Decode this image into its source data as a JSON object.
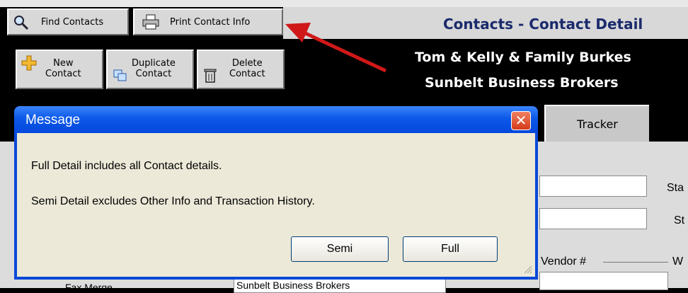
{
  "toolbar": {
    "find_contacts": "Find Contacts",
    "print_contact_info": "Print Contact Info",
    "new_contact": "New\nContact",
    "duplicate_contact": "Duplicate\nContact",
    "delete_contact": "Delete\nContact"
  },
  "header": {
    "title": "Contacts - Contact Detail",
    "contact_name": "Tom & Kelly & Family Burkes",
    "company": "Sunbelt Business Brokers"
  },
  "tabs": {
    "tracker": "Tracker"
  },
  "form": {
    "label_sta": "Sta",
    "label_st": "St",
    "vendor_label": "Vendor #",
    "w_label": "W",
    "partial_row_label": "Fax Merge",
    "partial_row_value": "Sunbelt Business Brokers"
  },
  "dialog": {
    "title": "Message",
    "line1": "Full Detail includes all Contact details.",
    "line2": "Semi Detail excludes Other Info and Transaction History.",
    "semi_button": "Semi",
    "full_button": "Full"
  },
  "icons": {
    "find": "magnifier-icon",
    "print": "printer-icon",
    "new": "plus-icon",
    "duplicate": "duplicate-icon",
    "delete": "trash-icon",
    "close": "close-icon"
  },
  "colors": {
    "title_text": "#1a2a6c",
    "dialog_blue": "#0a48d8",
    "annotation_arrow": "#d01818"
  }
}
